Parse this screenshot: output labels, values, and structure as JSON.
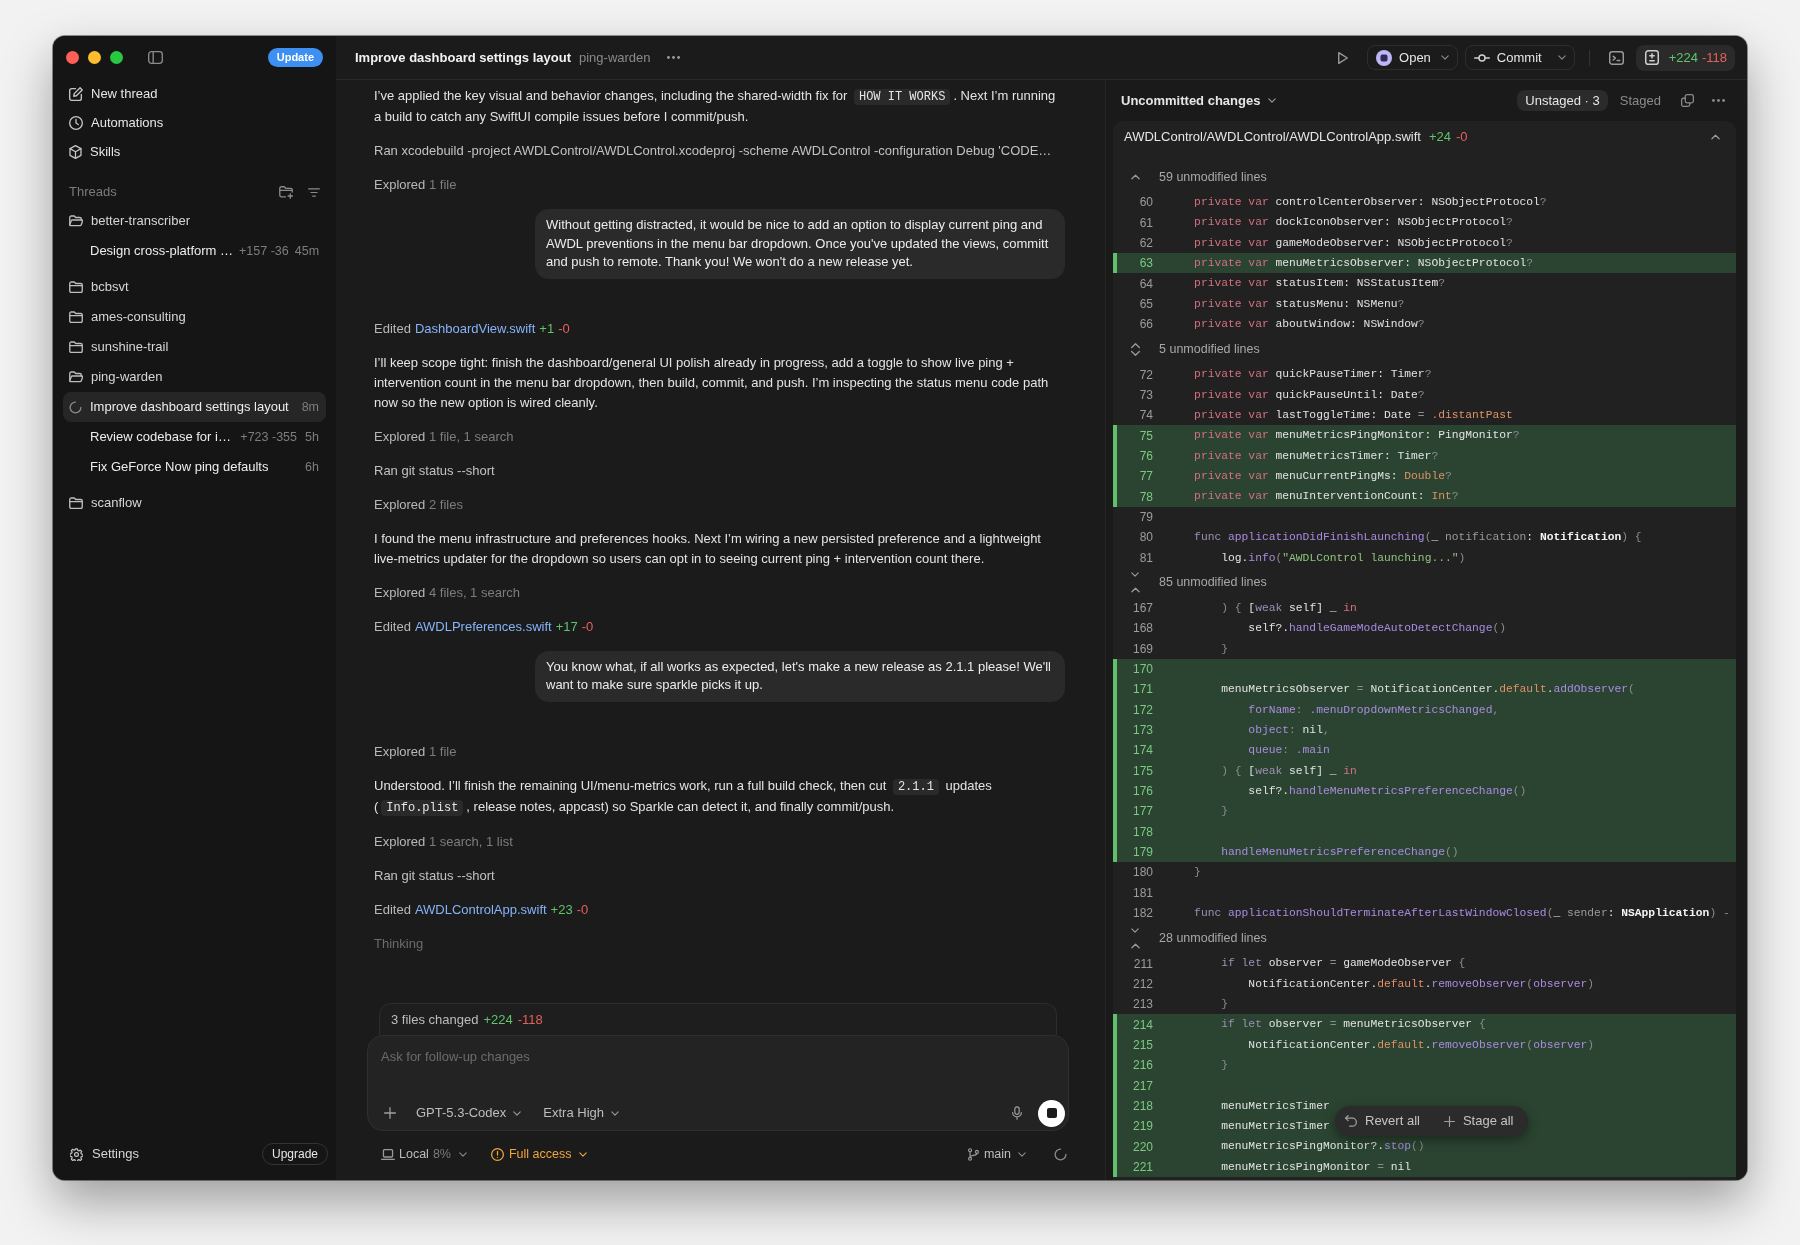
{
  "window": {
    "title": "Improve dashboard settings layout",
    "project": "ping-warden"
  },
  "sidebar": {
    "update_button": "Update",
    "nav": [
      {
        "label": "New thread"
      },
      {
        "label": "Automations"
      },
      {
        "label": "Skills"
      }
    ],
    "threads_header": "Threads",
    "projects": [
      {
        "name": "better-transcriber",
        "expanded": true,
        "children": [
          {
            "title": "Design cross-platform …",
            "stats": "+157 -36",
            "age": "45m",
            "selected": false,
            "running": false
          }
        ]
      },
      {
        "name": "bcbsvt",
        "expanded": false
      },
      {
        "name": "ames-consulting",
        "expanded": false
      },
      {
        "name": "sunshine-trail",
        "expanded": false
      },
      {
        "name": "ping-warden",
        "expanded": true,
        "children": [
          {
            "title": "Improve dashboard settings layout",
            "age": "8m",
            "selected": true,
            "running": true
          },
          {
            "title": "Review codebase for i…",
            "stats": "+723 -355",
            "age": "5h",
            "selected": false,
            "running": false
          },
          {
            "title": "Fix GeForce Now ping defaults",
            "age": "6h",
            "selected": false,
            "running": false
          }
        ]
      },
      {
        "name": "scanflow",
        "expanded": false
      }
    ],
    "settings": "Settings",
    "upgrade_button": "Upgrade"
  },
  "toolbar": {
    "open_button": "Open",
    "commit_button": "Commit",
    "additions": "+224",
    "deletions": "-118"
  },
  "chat": {
    "items": [
      {
        "kind": "text",
        "parts": [
          {
            "kind": "plain",
            "text": "I’ve applied the key visual and behavior changes, including the shared-width fix for "
          },
          {
            "kind": "code",
            "text": "HOW IT WORKS"
          },
          {
            "kind": "plain",
            "text": ". Next I’m running a build to catch any SwiftUI compile issues before I commit/push."
          }
        ]
      },
      {
        "kind": "command",
        "text": "Ran xcodebuild -project AWDLControl/AWDLControl.xcodeproj -scheme AWDLControl -configuration Debug 'CODE…"
      },
      {
        "kind": "explored",
        "verb": "Explored",
        "detail": "1 file"
      },
      {
        "kind": "user",
        "text": "Without getting distracted, it would be nice to add an option to display current ping and AWDL preventions in the menu bar dropdown. Once you've updated the views, committ and push to remote. Thank you! We won't do a new release yet."
      },
      {
        "kind": "edit",
        "verb": "Edited",
        "file": "DashboardView.swift",
        "additions": "+1",
        "deletions": "-0"
      },
      {
        "kind": "text",
        "parts": [
          {
            "kind": "plain",
            "text": "I’ll keep scope tight: finish the dashboard/general UI polish already in progress, add a toggle to show live ping + intervention count in the menu bar dropdown, then build, commit, and push. I’m inspecting the status menu code path now so the new option is wired cleanly."
          }
        ]
      },
      {
        "kind": "explored",
        "verb": "Explored",
        "detail": "1 file, 1 search"
      },
      {
        "kind": "command",
        "text": "Ran git status --short"
      },
      {
        "kind": "explored",
        "verb": "Explored",
        "detail": "2 files"
      },
      {
        "kind": "text",
        "parts": [
          {
            "kind": "plain",
            "text": "I found the menu infrastructure and preferences hooks. Next I’m wiring a new persisted preference and a lightweight live-metrics updater for the dropdown so users can opt in to seeing current ping + intervention count there."
          }
        ]
      },
      {
        "kind": "explored",
        "verb": "Explored",
        "detail": "4 files, 1 search"
      },
      {
        "kind": "edit",
        "verb": "Edited",
        "file": "AWDLPreferences.swift",
        "additions": "+17",
        "deletions": "-0"
      },
      {
        "kind": "user",
        "text": "You know what, if all works as expected, let's make a new release as 2.1.1 please! We'll want to make sure sparkle picks it up."
      },
      {
        "kind": "explored",
        "verb": "Explored",
        "detail": "1 file"
      },
      {
        "kind": "text",
        "parts": [
          {
            "kind": "plain",
            "text": "Understood. I’ll finish the remaining UI/menu-metrics work, run a full build check, then cut "
          },
          {
            "kind": "code",
            "text": "2.1.1"
          },
          {
            "kind": "plain",
            "text": " updates ("
          },
          {
            "kind": "code",
            "text": "Info.plist"
          },
          {
            "kind": "plain",
            "text": ", release notes, appcast) so Sparkle can detect it, and finally commit/push."
          }
        ]
      },
      {
        "kind": "explored",
        "verb": "Explored",
        "detail": "1 search, 1 list"
      },
      {
        "kind": "command",
        "text": "Ran git status --short"
      },
      {
        "kind": "edit",
        "verb": "Edited",
        "file": "AWDLControlApp.swift",
        "additions": "+23",
        "deletions": "-0"
      },
      {
        "kind": "status",
        "text": "Thinking"
      }
    ]
  },
  "composer": {
    "summary": {
      "label": "3 files changed",
      "additions": "+224",
      "deletions": "-118"
    },
    "placeholder": "Ask for follow-up changes",
    "model": "GPT-5.3-Codex",
    "reasoning": "Extra High",
    "environment": "Local",
    "usage": "8%",
    "access": "Full access",
    "branch": "main"
  },
  "diff": {
    "title": "Uncommitted changes",
    "tabs": [
      {
        "label": "Unstaged · 3",
        "selected": true
      },
      {
        "label": "Staged",
        "selected": false
      }
    ],
    "file": {
      "path": "AWDLControl/AWDLControl/AWDLControlApp.swift",
      "additions": "+24",
      "deletions": "-0",
      "expanded": true,
      "rows": [
        {
          "kind": "hunk",
          "label": "59 unmodified lines",
          "expand_up": true,
          "expand_down": false
        },
        {
          "kind": "line",
          "number": "60",
          "added": false,
          "tokens": [
            {
              "kind": "keyword",
              "text": "    private var "
            },
            {
              "kind": "identifier",
              "text": "controlCenterObserver: NSObjectProtocol"
            },
            {
              "kind": "punctuation",
              "text": "?"
            }
          ]
        },
        {
          "kind": "line",
          "number": "61",
          "added": false,
          "tokens": [
            {
              "kind": "keyword",
              "text": "    private var "
            },
            {
              "kind": "identifier",
              "text": "dockIconObserver: NSObjectProtocol"
            },
            {
              "kind": "punctuation",
              "text": "?"
            }
          ]
        },
        {
          "kind": "line",
          "number": "62",
          "added": false,
          "tokens": [
            {
              "kind": "keyword",
              "text": "    private var "
            },
            {
              "kind": "identifier",
              "text": "gameModeObserver: NSObjectProtocol"
            },
            {
              "kind": "punctuation",
              "text": "?"
            }
          ]
        },
        {
          "kind": "line",
          "number": "63",
          "added": true,
          "tokens": [
            {
              "kind": "keyword",
              "text": "    private var "
            },
            {
              "kind": "identifier",
              "text": "menuMetricsObserver: NSObjectProtocol"
            },
            {
              "kind": "punctuation",
              "text": "?"
            }
          ]
        },
        {
          "kind": "line",
          "number": "64",
          "added": false,
          "tokens": [
            {
              "kind": "keyword",
              "text": "    private var "
            },
            {
              "kind": "identifier",
              "text": "statusItem: NSStatusItem"
            },
            {
              "kind": "punctuation",
              "text": "?"
            }
          ]
        },
        {
          "kind": "line",
          "number": "65",
          "added": false,
          "tokens": [
            {
              "kind": "keyword",
              "text": "    private var "
            },
            {
              "kind": "identifier",
              "text": "statusMenu: NSMenu"
            },
            {
              "kind": "punctuation",
              "text": "?"
            }
          ]
        },
        {
          "kind": "line",
          "number": "66",
          "added": false,
          "tokens": [
            {
              "kind": "keyword",
              "text": "    private var "
            },
            {
              "kind": "identifier",
              "text": "aboutWindow: NSWindow"
            },
            {
              "kind": "punctuation",
              "text": "?"
            }
          ]
        },
        {
          "kind": "hunk",
          "label": "5 unmodified lines",
          "expand_up": true,
          "expand_down": true,
          "combined": true
        },
        {
          "kind": "line",
          "number": "72",
          "added": false,
          "tokens": [
            {
              "kind": "keyword",
              "text": "    private var "
            },
            {
              "kind": "identifier",
              "text": "quickPauseTimer: Timer"
            },
            {
              "kind": "punctuation",
              "text": "?"
            }
          ]
        },
        {
          "kind": "line",
          "number": "73",
          "added": false,
          "tokens": [
            {
              "kind": "keyword",
              "text": "    private var "
            },
            {
              "kind": "identifier",
              "text": "quickPauseUntil: Date"
            },
            {
              "kind": "punctuation",
              "text": "?"
            }
          ]
        },
        {
          "kind": "line",
          "number": "74",
          "added": false,
          "tokens": [
            {
              "kind": "keyword",
              "text": "    private var "
            },
            {
              "kind": "identifier",
              "text": "lastToggleTime: Date "
            },
            {
              "kind": "punctuation",
              "text": "= "
            },
            {
              "kind": "type",
              "text": ".distantPast"
            }
          ]
        },
        {
          "kind": "line",
          "number": "75",
          "added": true,
          "tokens": [
            {
              "kind": "keyword",
              "text": "    private var "
            },
            {
              "kind": "identifier",
              "text": "menuMetricsPingMonitor: PingMonitor"
            },
            {
              "kind": "punctuation",
              "text": "?"
            }
          ]
        },
        {
          "kind": "line",
          "number": "76",
          "added": true,
          "tokens": [
            {
              "kind": "keyword",
              "text": "    private var "
            },
            {
              "kind": "identifier",
              "text": "menuMetricsTimer: Timer"
            },
            {
              "kind": "punctuation",
              "text": "?"
            }
          ]
        },
        {
          "kind": "line",
          "number": "77",
          "added": true,
          "tokens": [
            {
              "kind": "keyword",
              "text": "    private var "
            },
            {
              "kind": "identifier",
              "text": "menuCurrentPingMs: "
            },
            {
              "kind": "type",
              "text": "Double"
            },
            {
              "kind": "punctuation",
              "text": "?"
            }
          ]
        },
        {
          "kind": "line",
          "number": "78",
          "added": true,
          "tokens": [
            {
              "kind": "keyword",
              "text": "    private var "
            },
            {
              "kind": "identifier",
              "text": "menuInterventionCount: "
            },
            {
              "kind": "type",
              "text": "Int"
            },
            {
              "kind": "punctuation",
              "text": "?"
            }
          ]
        },
        {
          "kind": "line",
          "number": "79",
          "added": false
        },
        {
          "kind": "line",
          "number": "80",
          "added": false,
          "tokens": [
            {
              "kind": "declaration",
              "text": "    func "
            },
            {
              "kind": "function",
              "text": "applicationDidFinishLaunching"
            },
            {
              "kind": "punctuation",
              "text": "("
            },
            {
              "kind": "identifier",
              "text": "_ "
            },
            {
              "kind": "parameter",
              "text": "notification"
            },
            {
              "kind": "identifier",
              "text": ": "
            },
            {
              "kind": "emphasis",
              "text": "Notification"
            },
            {
              "kind": "punctuation",
              "text": ") {"
            }
          ]
        },
        {
          "kind": "line",
          "number": "81",
          "added": false,
          "tokens": [
            {
              "kind": "identifier",
              "text": "        log."
            },
            {
              "kind": "function",
              "text": "info"
            },
            {
              "kind": "punctuation",
              "text": "("
            },
            {
              "kind": "string",
              "text": "\"AWDLControl launching...\""
            },
            {
              "kind": "punctuation",
              "text": ")"
            }
          ]
        },
        {
          "kind": "hunk",
          "label": "85 unmodified lines",
          "expand_up": true,
          "expand_down": true,
          "combined": false
        },
        {
          "kind": "line",
          "number": "167",
          "added": false,
          "tokens": [
            {
              "kind": "punctuation",
              "text": "        ) { "
            },
            {
              "kind": "identifier",
              "text": "["
            },
            {
              "kind": "declaration",
              "text": "weak"
            },
            {
              "kind": "identifier",
              "text": " self] _ "
            },
            {
              "kind": "keyword",
              "text": "in"
            }
          ]
        },
        {
          "kind": "line",
          "number": "168",
          "added": false,
          "tokens": [
            {
              "kind": "identifier",
              "text": "            self?."
            },
            {
              "kind": "function",
              "text": "handleGameModeAutoDetectChange"
            },
            {
              "kind": "punctuation",
              "text": "()"
            }
          ]
        },
        {
          "kind": "line",
          "number": "169",
          "added": false,
          "tokens": [
            {
              "kind": "punctuation",
              "text": "        }"
            }
          ]
        },
        {
          "kind": "line",
          "number": "170",
          "added": true
        },
        {
          "kind": "line",
          "number": "171",
          "added": true,
          "tokens": [
            {
              "kind": "identifier",
              "text": "        menuMetricsObserver "
            },
            {
              "kind": "punctuation",
              "text": "= "
            },
            {
              "kind": "identifier",
              "text": "NotificationCenter."
            },
            {
              "kind": "type",
              "text": "default"
            },
            {
              "kind": "identifier",
              "text": "."
            },
            {
              "kind": "function",
              "text": "addObserver"
            },
            {
              "kind": "punctuation",
              "text": "("
            }
          ]
        },
        {
          "kind": "line",
          "number": "172",
          "added": true,
          "tokens": [
            {
              "kind": "function",
              "text": "            forName"
            },
            {
              "kind": "punctuation",
              "text": ": "
            },
            {
              "kind": "function",
              "text": ".menuDropdownMetricsChanged"
            },
            {
              "kind": "punctuation",
              "text": ","
            }
          ]
        },
        {
          "kind": "line",
          "number": "173",
          "added": true,
          "tokens": [
            {
              "kind": "function",
              "text": "            object"
            },
            {
              "kind": "punctuation",
              "text": ": "
            },
            {
              "kind": "identifier",
              "text": "nil"
            },
            {
              "kind": "punctuation",
              "text": ","
            }
          ]
        },
        {
          "kind": "line",
          "number": "174",
          "added": true,
          "tokens": [
            {
              "kind": "function",
              "text": "            queue"
            },
            {
              "kind": "punctuation",
              "text": ": "
            },
            {
              "kind": "function",
              "text": ".main"
            }
          ]
        },
        {
          "kind": "line",
          "number": "175",
          "added": true,
          "tokens": [
            {
              "kind": "punctuation",
              "text": "        ) { "
            },
            {
              "kind": "identifier",
              "text": "["
            },
            {
              "kind": "declaration",
              "text": "weak"
            },
            {
              "kind": "identifier",
              "text": " self] _ "
            },
            {
              "kind": "keyword",
              "text": "in"
            }
          ]
        },
        {
          "kind": "line",
          "number": "176",
          "added": true,
          "tokens": [
            {
              "kind": "identifier",
              "text": "            self?."
            },
            {
              "kind": "function",
              "text": "handleMenuMetricsPreferenceChange"
            },
            {
              "kind": "punctuation",
              "text": "()"
            }
          ]
        },
        {
          "kind": "line",
          "number": "177",
          "added": true,
          "tokens": [
            {
              "kind": "punctuation",
              "text": "        }"
            }
          ]
        },
        {
          "kind": "line",
          "number": "178",
          "added": true
        },
        {
          "kind": "line",
          "number": "179",
          "added": true,
          "tokens": [
            {
              "kind": "function",
              "text": "        handleMenuMetricsPreferenceChange"
            },
            {
              "kind": "punctuation",
              "text": "()"
            }
          ]
        },
        {
          "kind": "line",
          "number": "180",
          "added": false,
          "tokens": [
            {
              "kind": "punctuation",
              "text": "    }"
            }
          ]
        },
        {
          "kind": "line",
          "number": "181",
          "added": false
        },
        {
          "kind": "line",
          "number": "182",
          "added": false,
          "tokens": [
            {
              "kind": "declaration",
              "text": "    func "
            },
            {
              "kind": "function",
              "text": "applicationShouldTerminateAfterLastWindowClosed"
            },
            {
              "kind": "punctuation",
              "text": "("
            },
            {
              "kind": "identifier",
              "text": "_ "
            },
            {
              "kind": "parameter",
              "text": "sender"
            },
            {
              "kind": "identifier",
              "text": ": "
            },
            {
              "kind": "emphasis",
              "text": "NSApplication"
            },
            {
              "kind": "punctuation",
              "text": ") -"
            }
          ]
        },
        {
          "kind": "hunk",
          "label": "28 unmodified lines",
          "expand_up": true,
          "expand_down": true,
          "combined": false
        },
        {
          "kind": "line",
          "number": "211",
          "added": false,
          "tokens": [
            {
              "kind": "declaration",
              "text": "        if let "
            },
            {
              "kind": "identifier",
              "text": "observer "
            },
            {
              "kind": "punctuation",
              "text": "= "
            },
            {
              "kind": "identifier",
              "text": "gameModeObserver "
            },
            {
              "kind": "punctuation",
              "text": "{"
            }
          ]
        },
        {
          "kind": "line",
          "number": "212",
          "added": false,
          "tokens": [
            {
              "kind": "identifier",
              "text": "            NotificationCenter."
            },
            {
              "kind": "type",
              "text": "default"
            },
            {
              "kind": "identifier",
              "text": "."
            },
            {
              "kind": "function",
              "text": "removeObserver"
            },
            {
              "kind": "punctuation",
              "text": "("
            },
            {
              "kind": "function",
              "text": "observer"
            },
            {
              "kind": "punctuation",
              "text": ")"
            }
          ]
        },
        {
          "kind": "line",
          "number": "213",
          "added": false,
          "tokens": [
            {
              "kind": "punctuation",
              "text": "        }"
            }
          ]
        },
        {
          "kind": "line",
          "number": "214",
          "added": true,
          "tokens": [
            {
              "kind": "declaration",
              "text": "        if let "
            },
            {
              "kind": "identifier",
              "text": "observer "
            },
            {
              "kind": "punctuation",
              "text": "= "
            },
            {
              "kind": "identifier",
              "text": "menuMetricsObserver "
            },
            {
              "kind": "punctuation",
              "text": "{"
            }
          ]
        },
        {
          "kind": "line",
          "number": "215",
          "added": true,
          "tokens": [
            {
              "kind": "identifier",
              "text": "            NotificationCenter."
            },
            {
              "kind": "type",
              "text": "default"
            },
            {
              "kind": "identifier",
              "text": "."
            },
            {
              "kind": "function",
              "text": "removeObserver"
            },
            {
              "kind": "punctuation",
              "text": "("
            },
            {
              "kind": "function",
              "text": "observer"
            },
            {
              "kind": "punctuation",
              "text": ")"
            }
          ]
        },
        {
          "kind": "line",
          "number": "216",
          "added": true,
          "tokens": [
            {
              "kind": "punctuation",
              "text": "        }"
            }
          ]
        },
        {
          "kind": "line",
          "number": "217",
          "added": true
        },
        {
          "kind": "line",
          "number": "218",
          "added": true,
          "tokens": [
            {
              "kind": "identifier",
              "text": "        menuMetricsTimer"
            }
          ]
        },
        {
          "kind": "line",
          "number": "219",
          "added": true,
          "tokens": [
            {
              "kind": "identifier",
              "text": "        menuMetricsTimer"
            }
          ]
        },
        {
          "kind": "line",
          "number": "220",
          "added": true,
          "tokens": [
            {
              "kind": "identifier",
              "text": "        menuMetricsPingMonitor?."
            },
            {
              "kind": "function",
              "text": "stop"
            },
            {
              "kind": "punctuation",
              "text": "()"
            }
          ]
        },
        {
          "kind": "line",
          "number": "221",
          "added": true,
          "tokens": [
            {
              "kind": "identifier",
              "text": "        menuMetricsPingMonitor "
            },
            {
              "kind": "punctuation",
              "text": "= "
            },
            {
              "kind": "identifier",
              "text": "nil"
            }
          ]
        }
      ]
    },
    "actions": [
      {
        "label": "Revert all"
      },
      {
        "label": "Stage all"
      }
    ]
  }
}
